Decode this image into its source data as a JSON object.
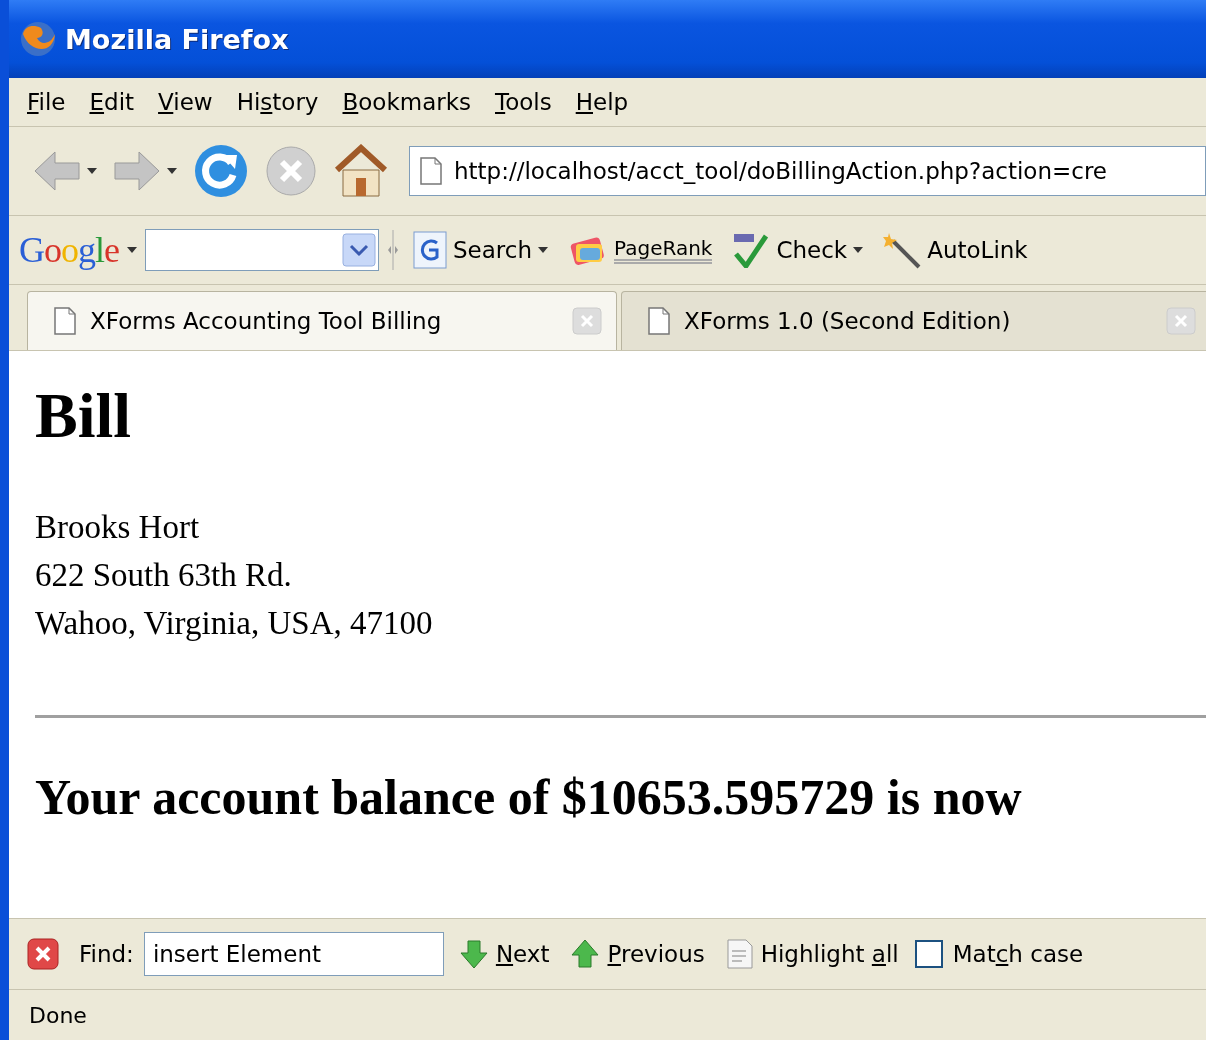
{
  "window": {
    "title": "Mozilla Firefox"
  },
  "menu": [
    {
      "key": "F",
      "post": "ile"
    },
    {
      "key": "E",
      "post": "dit"
    },
    {
      "key": "V",
      "post": "iew"
    },
    {
      "pre": "Hi",
      "key": "s",
      "post": "tory"
    },
    {
      "key": "B",
      "post": "ookmarks"
    },
    {
      "key": "T",
      "post": "ools"
    },
    {
      "key": "H",
      "post": "elp"
    }
  ],
  "nav_buttons": [
    {
      "kind": "back",
      "disabled": true,
      "dropdown": true
    },
    {
      "kind": "forward",
      "disabled": true,
      "dropdown": true
    },
    {
      "kind": "reload",
      "disabled": false,
      "dropdown": false
    },
    {
      "kind": "stop",
      "disabled": true,
      "dropdown": false
    },
    {
      "kind": "home",
      "disabled": false,
      "dropdown": false
    }
  ],
  "address": {
    "value": "http://localhost/acct_tool/doBillingAction.php?action=cre"
  },
  "google_toolbar": {
    "logo": "Google",
    "buttons": [
      {
        "kind": "search",
        "label": "Search",
        "dropdown": true
      },
      {
        "kind": "pagerank",
        "label": "PageRank",
        "dropdown": false
      },
      {
        "kind": "spell",
        "label": "Check",
        "dropdown": true
      },
      {
        "kind": "autolink",
        "label": "AutoLink",
        "dropdown": false
      }
    ]
  },
  "tabs": [
    {
      "title": "XForms Accounting Tool Billing",
      "selected": true
    },
    {
      "title": "XForms 1.0 (Second Edition)",
      "selected": false
    }
  ],
  "page": {
    "heading": "Bill",
    "address_lines": [
      "Brooks Hort",
      "622 South 63th Rd.",
      "Wahoo, Virginia, USA, 47100"
    ],
    "balance": "Your account balance of $10653.595729 is now"
  },
  "find_bar": {
    "label": "Find:",
    "value": "insert Element",
    "buttons": [
      {
        "kind": "next",
        "key": "N",
        "post": "ext"
      },
      {
        "kind": "previous",
        "key": "P",
        "post": "revious"
      },
      {
        "kind": "highlight",
        "pre": "Highlight ",
        "key": "a",
        "post": "ll"
      }
    ],
    "match_case": {
      "pre": "Mat",
      "key": "c",
      "post": "h case",
      "checked": false
    }
  },
  "status_bar": {
    "text": "Done"
  }
}
